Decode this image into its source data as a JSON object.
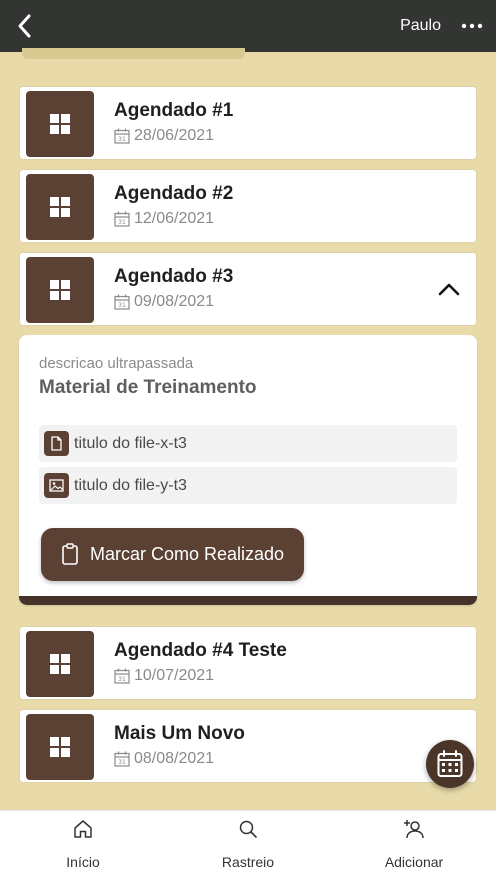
{
  "appbar": {
    "user": "Paulo",
    "back_icon": "back-arrow-icon",
    "more_icon": "more-horizontal-icon"
  },
  "items": [
    {
      "title": "Agendado #1",
      "date": "28/06/2021"
    },
    {
      "title": "Agendado #2",
      "date": "12/06/2021"
    },
    {
      "title": "Agendado #3",
      "date": "09/08/2021"
    },
    {
      "title": "Agendado #4 Teste",
      "date": "10/07/2021"
    },
    {
      "title": "Mais Um Novo",
      "date": "08/08/2021"
    }
  ],
  "expanded": {
    "description": "descricao ultrapassada",
    "heading": "Material de Treinamento",
    "files": [
      {
        "name": "titulo do file-x-t3",
        "icon": "document-icon"
      },
      {
        "name": "titulo do file-y-t3",
        "icon": "image-icon"
      }
    ],
    "action_label": "Marcar Como Realizado"
  },
  "nav": [
    {
      "label": "Início",
      "icon": "home-icon"
    },
    {
      "label": "Rastreio",
      "icon": "search-icon"
    },
    {
      "label": "Adicionar",
      "icon": "add-user-icon"
    }
  ],
  "colors": {
    "appbar": "#333533",
    "background": "#e8dba9",
    "brand": "#5b4133"
  }
}
